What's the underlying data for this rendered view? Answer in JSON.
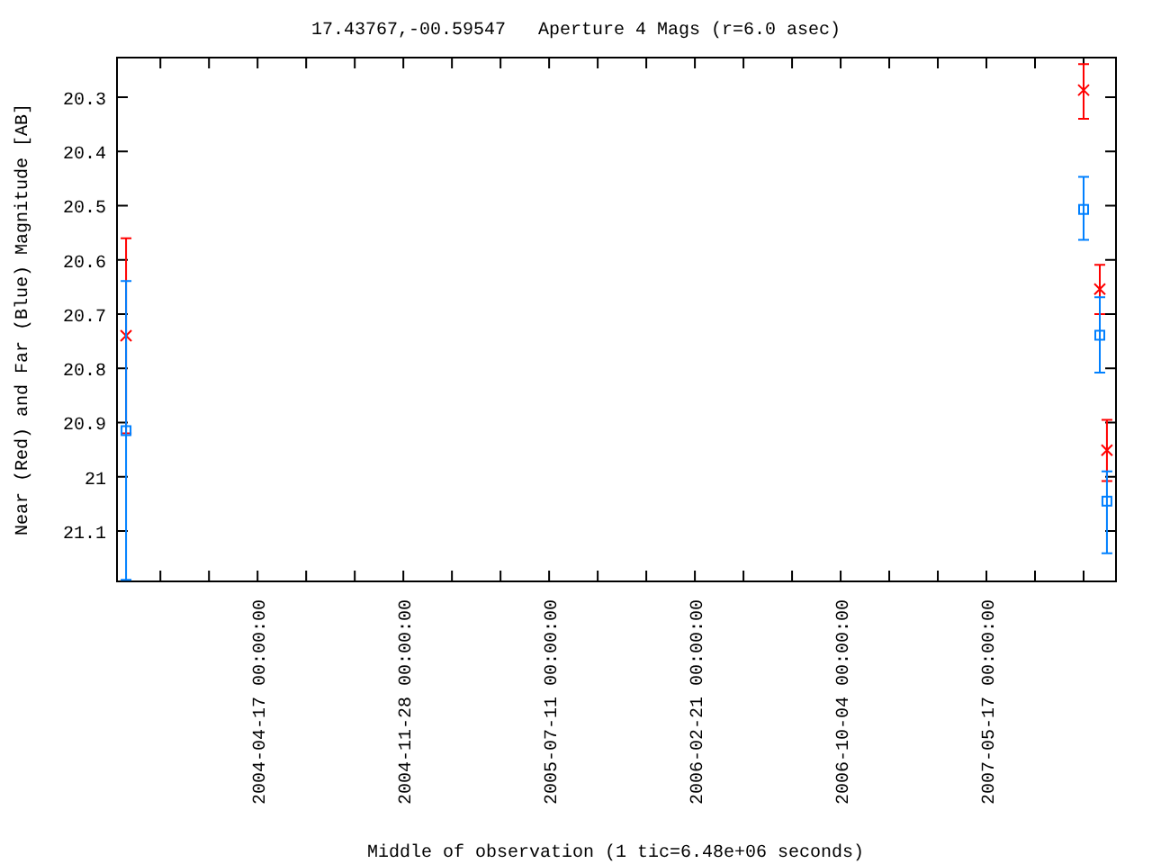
{
  "chart_data": {
    "type": "scatter",
    "title": "17.43767,-00.59547   Aperture 4 Mags (r=6.0 asec)",
    "xlabel": "Middle of observation (1 tic=6.48e+06 seconds)",
    "ylabel": "Near (Red) and Far (Blue) Magnitude [AB]",
    "x": [
      "2003-09-27",
      "2007-10-14",
      "2007-11-08",
      "2007-11-19"
    ],
    "series": [
      {
        "color": "#ff0000",
        "marker": "cross",
        "values": [
          20.74,
          20.287,
          20.654,
          20.951
        ],
        "errors": [
          [
            20.56,
            20.92
          ],
          [
            20.239,
            20.34
          ],
          [
            20.609,
            20.7
          ],
          [
            20.895,
            21.008
          ]
        ]
      },
      {
        "color": "#0080ff",
        "marker": "square",
        "values": [
          20.915,
          20.507,
          20.739,
          21.045
        ],
        "errors": [
          [
            20.639,
            21.19
          ],
          [
            20.447,
            20.563
          ],
          [
            20.669,
            20.808
          ],
          [
            20.99,
            21.141
          ]
        ]
      }
    ],
    "xlim": [
      "2003-09-13",
      "2007-12-03"
    ],
    "ylim": [
      21.193,
      20.227
    ],
    "xticks": [
      {
        "value": "2004-04-17",
        "label": "2004-04-17 00:00:00"
      },
      {
        "value": "2004-11-28",
        "label": "2004-11-28 00:00:00"
      },
      {
        "value": "2005-07-11",
        "label": "2005-07-11 00:00:00"
      },
      {
        "value": "2006-02-21",
        "label": "2006-02-21 00:00:00"
      },
      {
        "value": "2006-10-04",
        "label": "2006-10-04 00:00:00"
      },
      {
        "value": "2007-05-17",
        "label": "2007-05-17 00:00:00"
      }
    ],
    "yticks": [
      20.3,
      20.4,
      20.5,
      20.6,
      20.7,
      20.8,
      20.9,
      21,
      21.1
    ]
  }
}
